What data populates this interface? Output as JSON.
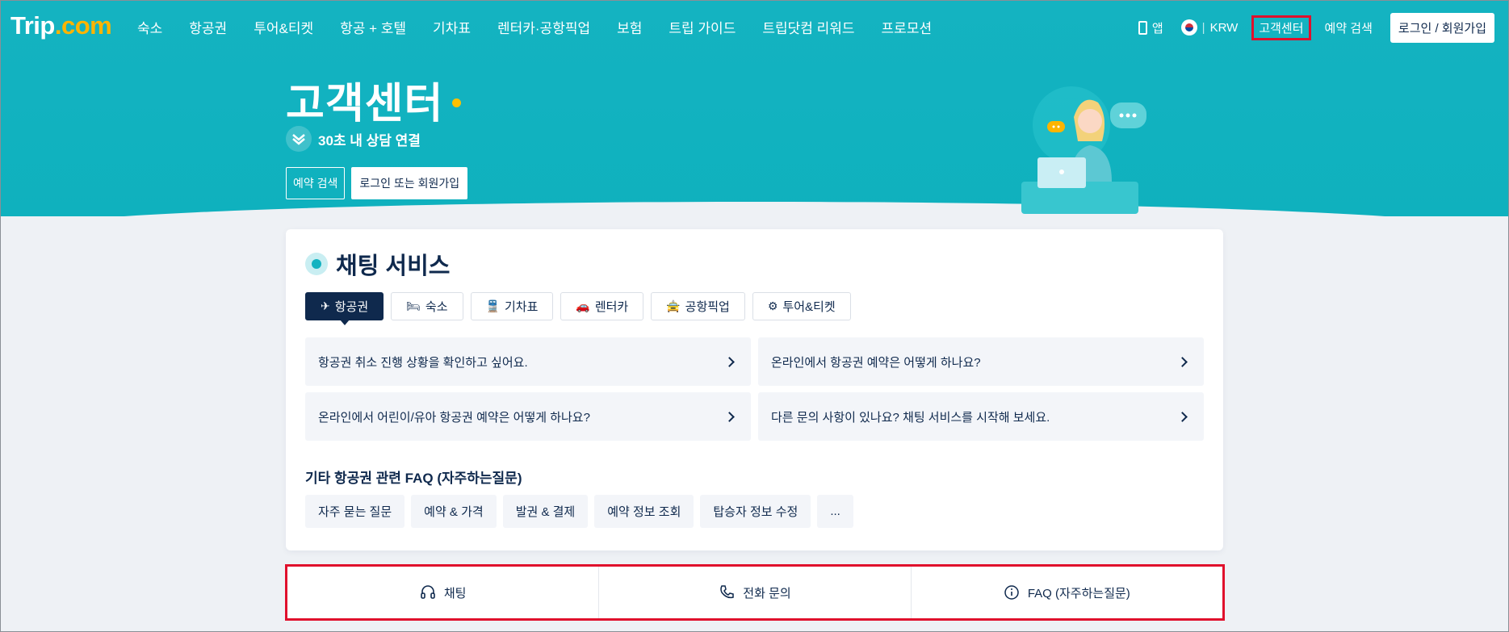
{
  "nav": {
    "logo_text": "Trip",
    "logo_suffix": ".com",
    "links": [
      "숙소",
      "항공권",
      "투어&티켓",
      "항공 + 호텔",
      "기차표",
      "렌터카·공항픽업",
      "보험",
      "트립 가이드",
      "트립닷컴 리워드",
      "프로모션"
    ],
    "app_label": "앱",
    "currency": "KRW",
    "customer_center": "고객센터",
    "booking_search": "예약 검색",
    "login": "로그인 / 회원가입"
  },
  "hero": {
    "title": "고객센터",
    "badge": "30초 내 상담 연결",
    "btn_booking": "예약 검색",
    "btn_login": "로그인 또는 회원가입"
  },
  "chat": {
    "title": "채팅 서비스",
    "tabs": [
      {
        "label": "항공권",
        "icon": "plane-icon",
        "active": true
      },
      {
        "label": "숙소",
        "icon": "bed-icon",
        "active": false
      },
      {
        "label": "기차표",
        "icon": "train-icon",
        "active": false
      },
      {
        "label": "렌터카",
        "icon": "car-icon",
        "active": false
      },
      {
        "label": "공항픽업",
        "icon": "pickup-icon",
        "active": false
      },
      {
        "label": "투어&티켓",
        "icon": "ticket-icon",
        "active": false
      }
    ],
    "questions": [
      "항공권 취소 진행 상황을 확인하고 싶어요.",
      "온라인에서 항공권 예약은 어떻게 하나요?",
      "온라인에서 어린이/유아 항공권 예약은 어떻게 하나요?",
      "다른 문의 사항이 있나요? 채팅 서비스를 시작해 보세요."
    ],
    "faq_label": "기타 항공권 관련 FAQ (자주하는질문)",
    "faq_chips": [
      "자주 묻는 질문",
      "예약 & 가격",
      "발권 & 결제",
      "예약 정보 조회",
      "탑승자 정보 수정",
      "..."
    ]
  },
  "bottom_bar": {
    "items": [
      {
        "label": "채팅",
        "icon": "headset-icon"
      },
      {
        "label": "전화 문의",
        "icon": "phone-icon"
      },
      {
        "label": "FAQ (자주하는질문)",
        "icon": "info-icon"
      }
    ]
  },
  "colors": {
    "hero": "#14b3c1",
    "navy": "#0f294d",
    "highlight": "#e0102c",
    "accent_dot": "#ffc000"
  }
}
